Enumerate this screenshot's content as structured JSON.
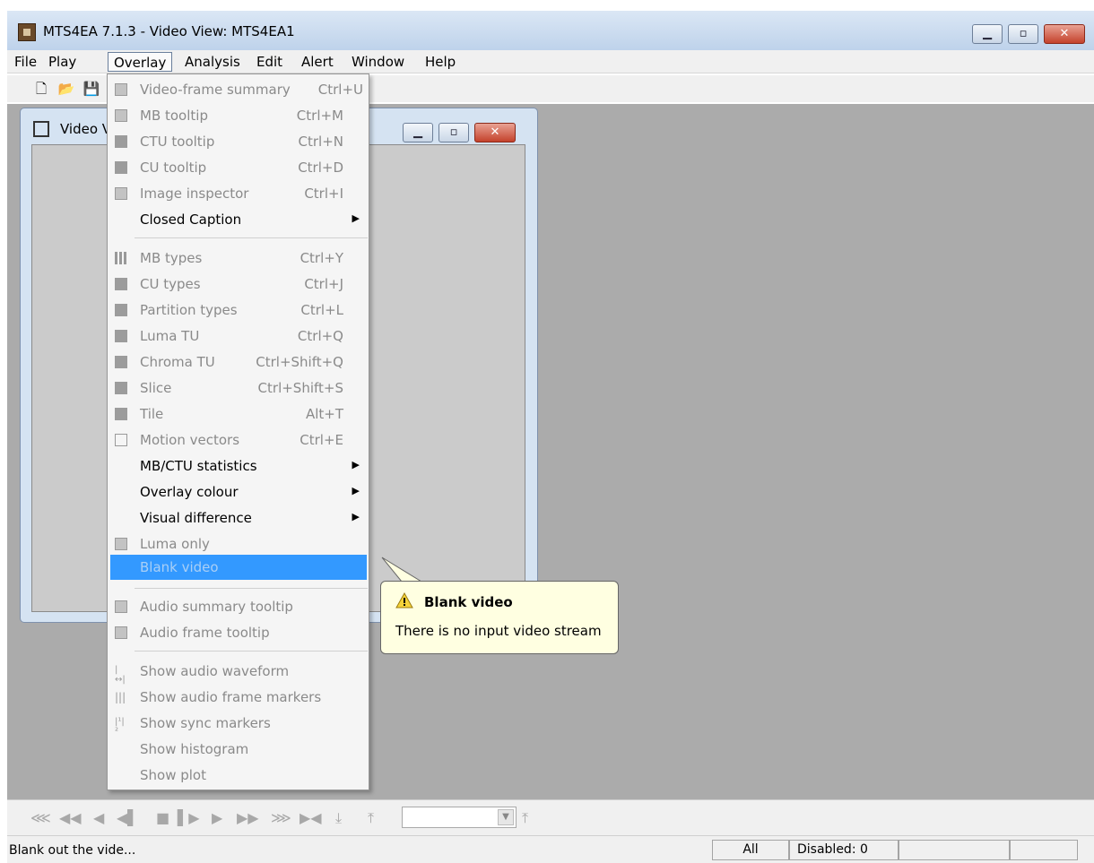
{
  "window": {
    "title": "MTS4EA 7.1.3 - Video View: MTS4EA1"
  },
  "menubar": [
    "File",
    "Play",
    "Overlay",
    "Analysis",
    "Edit",
    "Alert",
    "Window",
    "Help"
  ],
  "video_window": {
    "title": "Video V"
  },
  "overlay_menu": {
    "items": [
      {
        "label": "Video-frame summary",
        "shortcut": "Ctrl+U"
      },
      {
        "label": "MB tooltip",
        "shortcut": "Ctrl+M"
      },
      {
        "label": "CTU tooltip",
        "shortcut": "Ctrl+N"
      },
      {
        "label": "CU tooltip",
        "shortcut": "Ctrl+D"
      },
      {
        "label": "Image inspector",
        "shortcut": "Ctrl+I"
      },
      {
        "label": "Closed Caption",
        "shortcut": ""
      },
      {
        "label": "MB types",
        "shortcut": "Ctrl+Y"
      },
      {
        "label": "CU types",
        "shortcut": "Ctrl+J"
      },
      {
        "label": "Partition types",
        "shortcut": "Ctrl+L"
      },
      {
        "label": "Luma TU",
        "shortcut": "Ctrl+Q"
      },
      {
        "label": "Chroma TU",
        "shortcut": "Ctrl+Shift+Q"
      },
      {
        "label": "Slice",
        "shortcut": "Ctrl+Shift+S"
      },
      {
        "label": "Tile",
        "shortcut": "Alt+T"
      },
      {
        "label": "Motion vectors",
        "shortcut": "Ctrl+E"
      },
      {
        "label": "MB/CTU statistics",
        "shortcut": ""
      },
      {
        "label": "Overlay colour",
        "shortcut": ""
      },
      {
        "label": "Visual difference",
        "shortcut": ""
      },
      {
        "label": "Luma only",
        "shortcut": ""
      },
      {
        "label": "Blank video",
        "shortcut": ""
      },
      {
        "label": "Audio summary tooltip",
        "shortcut": ""
      },
      {
        "label": "Audio frame tooltip",
        "shortcut": ""
      },
      {
        "label": "Show audio waveform",
        "shortcut": ""
      },
      {
        "label": "Show audio frame markers",
        "shortcut": ""
      },
      {
        "label": "Show sync markers",
        "shortcut": ""
      },
      {
        "label": "Show histogram",
        "shortcut": ""
      },
      {
        "label": "Show plot",
        "shortcut": ""
      }
    ]
  },
  "tooltip": {
    "title": "Blank video",
    "body": "There is no input video stream"
  },
  "status": {
    "text": "Blank out the vide...",
    "panel_all": "All",
    "panel_disabled": "Disabled: 0"
  },
  "colors": {
    "highlight": "#3399ff",
    "tooltip_bg": "#ffffe1",
    "mdi_bg": "#ababab"
  }
}
